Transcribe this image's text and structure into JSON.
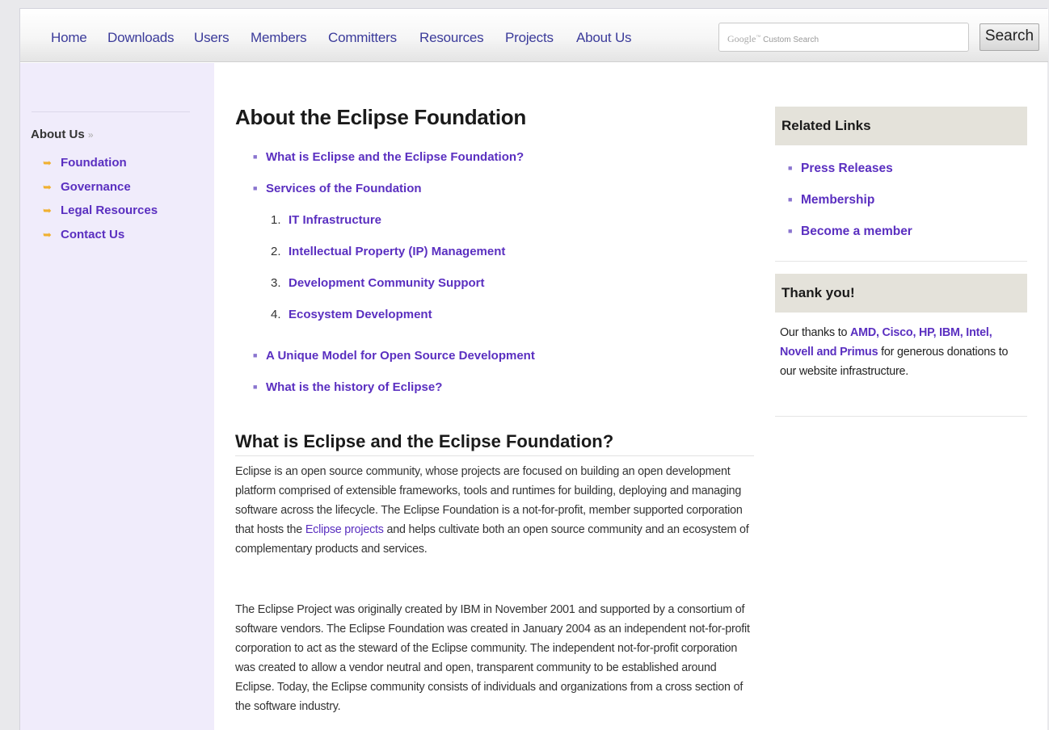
{
  "nav": {
    "items": [
      "Home",
      "Downloads",
      "Users",
      "Members",
      "Committers",
      "Resources",
      "Projects",
      "About Us"
    ]
  },
  "search": {
    "logo": "Google",
    "placeholder": "Custom Search",
    "button_label": "Search"
  },
  "sidebar": {
    "heading": "About Us",
    "heading_suffix": "»",
    "items": [
      "Foundation",
      "Governance",
      "Legal Resources",
      "Contact Us"
    ]
  },
  "main": {
    "title": "About the Eclipse Foundation",
    "toc": {
      "item1": "What is Eclipse and the Eclipse Foundation?",
      "item2": "Services of the Foundation",
      "sub": [
        {
          "num": "1.",
          "label": "IT Infrastructure"
        },
        {
          "num": "2.",
          "label": "Intellectual Property (IP) Management"
        },
        {
          "num": "3.",
          "label": "Development Community Support"
        },
        {
          "num": "4.",
          "label": "Ecosystem Development"
        }
      ],
      "item3": "A Unique Model for Open Source Development",
      "item4": "What is the history of Eclipse?"
    },
    "section_title": "What is Eclipse and the Eclipse Foundation?",
    "para1_before": "Eclipse is an open source community, whose projects are focused on building an open development platform comprised of extensible frameworks, tools and runtimes for building, deploying and managing software across the lifecycle. The Eclipse Foundation is a not-for-profit, member supported corporation that hosts the",
    "para1_link": "Eclipse projects",
    "para1_after": "and helps cultivate both an open source community and an ecosystem of complementary products and services.",
    "para2": "The Eclipse Project was originally created by IBM in November 2001 and supported by a consortium of software vendors. The Eclipse Foundation was created in January 2004 as an independent not-for-profit corporation to act as the steward of the Eclipse community. The independent not-for-profit corporation was created to allow a vendor neutral and open, transparent community to be established around Eclipse. Today, the Eclipse community consists of individuals and organizations from a cross section of the software industry."
  },
  "right": {
    "related_title": "Related Links",
    "related_links": [
      "Press Releases",
      "Membership",
      "Become a member"
    ],
    "thanks_title": "Thank you!",
    "thanks_before": "Our thanks to",
    "thanks_link1": "AMD, Cisco, HP, IBM, Intel, Novell and Primus",
    "thanks_after": "for generous donations to our website infrastructure."
  },
  "colors": {
    "link": "#5a2fc0",
    "nav_link": "#3b3b9a",
    "sidebar_bg": "#f0ecfb",
    "box_head_bg": "#e4e2da",
    "bullet_arrow": "#f0b030"
  }
}
